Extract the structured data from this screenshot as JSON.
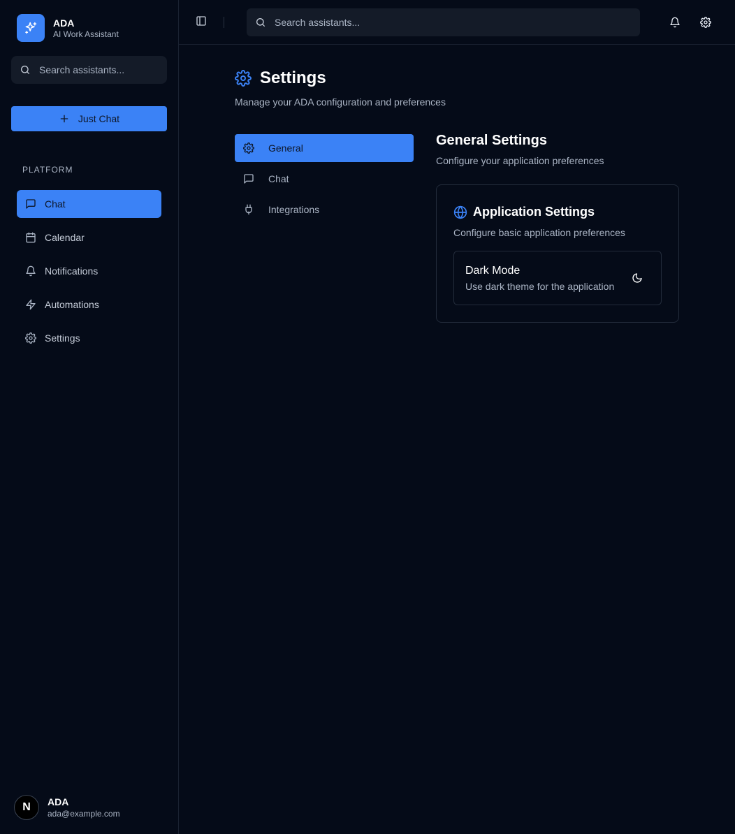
{
  "app": {
    "name": "ADA",
    "subtitle": "AI Work Assistant"
  },
  "sidebar": {
    "search_placeholder": "Search assistants...",
    "new_chat_label": "Just Chat",
    "section_label": "PLATFORM",
    "items": [
      {
        "label": "Chat",
        "icon": "message-square-icon",
        "active": true
      },
      {
        "label": "Calendar",
        "icon": "calendar-icon",
        "active": false
      },
      {
        "label": "Notifications",
        "icon": "bell-icon",
        "active": false
      },
      {
        "label": "Automations",
        "icon": "zap-icon",
        "active": false
      },
      {
        "label": "Settings",
        "icon": "gear-icon",
        "active": false
      }
    ],
    "user": {
      "avatar_letter": "N",
      "name": "ADA",
      "email": "ada@example.com"
    }
  },
  "topbar": {
    "search_placeholder": "Search assistants..."
  },
  "page": {
    "title": "Settings",
    "subtitle": "Manage your ADA configuration and preferences",
    "tabs": [
      {
        "label": "General",
        "icon": "gear-icon",
        "active": true
      },
      {
        "label": "Chat",
        "icon": "message-square-icon",
        "active": false
      },
      {
        "label": "Integrations",
        "icon": "plug-icon",
        "active": false
      }
    ]
  },
  "general": {
    "title": "General Settings",
    "subtitle": "Configure your application preferences",
    "card": {
      "title": "Application Settings",
      "subtitle": "Configure basic application preferences",
      "dark_mode": {
        "title": "Dark Mode",
        "description": "Use dark theme for the application",
        "enabled": true
      }
    }
  },
  "colors": {
    "accent": "#3b82f6",
    "background": "#050b18",
    "muted_text": "#aab4c4"
  }
}
